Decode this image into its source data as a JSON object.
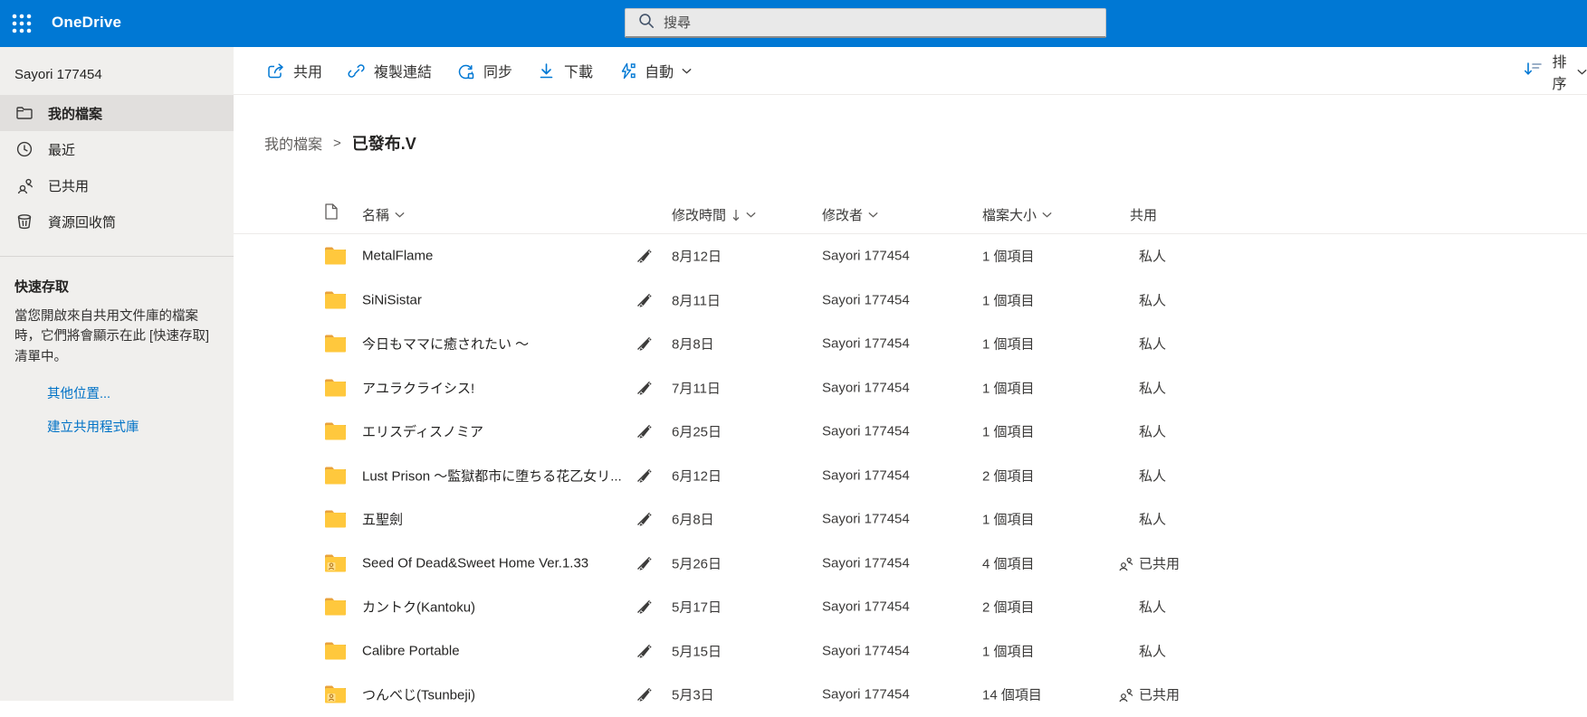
{
  "header": {
    "app_name": "OneDrive",
    "search_placeholder": "搜尋"
  },
  "sidebar": {
    "account_name": "Sayori 177454",
    "items": [
      {
        "label": "我的檔案",
        "icon": "folder-icon",
        "selected": true
      },
      {
        "label": "最近",
        "icon": "clock-icon",
        "selected": false
      },
      {
        "label": "已共用",
        "icon": "people-icon",
        "selected": false
      },
      {
        "label": "資源回收筒",
        "icon": "recycle-bin-icon",
        "selected": false
      }
    ],
    "quick_access": {
      "title": "快速存取",
      "description": "當您開啟來自共用文件庫的檔案時，它們將會顯示在此 [快速存取] 清單中。",
      "links": [
        {
          "label": "其他位置..."
        },
        {
          "label": "建立共用程式庫"
        }
      ]
    }
  },
  "toolbar": {
    "actions": [
      {
        "label": "共用",
        "icon": "share-icon"
      },
      {
        "label": "複製連結",
        "icon": "copy-link-icon"
      },
      {
        "label": "同步",
        "icon": "sync-icon"
      },
      {
        "label": "下載",
        "icon": "download-icon"
      },
      {
        "label": "自動",
        "icon": "automate-icon",
        "has_dropdown": true
      }
    ],
    "sort_label": "排序"
  },
  "breadcrumb": {
    "parent": "我的檔案",
    "separator": ">",
    "current": "已發布.V"
  },
  "table": {
    "columns": {
      "name": "名稱",
      "modified": "修改時間",
      "modified_by": "修改者",
      "file_size": "檔案大小",
      "sharing": "共用"
    },
    "sorted_by": "修改時間",
    "sort_direction": "descending",
    "rows": [
      {
        "name": "MetalFlame",
        "modified": "8月12日",
        "modified_by": "Sayori 177454",
        "file_size": "1 個項目",
        "sharing": "私人",
        "shared": false
      },
      {
        "name": "SiNiSistar",
        "modified": "8月11日",
        "modified_by": "Sayori 177454",
        "file_size": "1 個項目",
        "sharing": "私人",
        "shared": false
      },
      {
        "name": "今日もママに癒されたい ～",
        "modified": "8月8日",
        "modified_by": "Sayori 177454",
        "file_size": "1 個項目",
        "sharing": "私人",
        "shared": false
      },
      {
        "name": "アユラクライシス!",
        "modified": "7月11日",
        "modified_by": "Sayori 177454",
        "file_size": "1 個項目",
        "sharing": "私人",
        "shared": false
      },
      {
        "name": "エリスディスノミア",
        "modified": "6月25日",
        "modified_by": "Sayori 177454",
        "file_size": "1 個項目",
        "sharing": "私人",
        "shared": false
      },
      {
        "name": "Lust Prison ～監獄都市に堕ちる花乙女リ...",
        "modified": "6月12日",
        "modified_by": "Sayori 177454",
        "file_size": "2 個項目",
        "sharing": "私人",
        "shared": false
      },
      {
        "name": "五聖劍",
        "modified": "6月8日",
        "modified_by": "Sayori 177454",
        "file_size": "1 個項目",
        "sharing": "私人",
        "shared": false
      },
      {
        "name": "Seed Of Dead&Sweet Home Ver.1.33",
        "modified": "5月26日",
        "modified_by": "Sayori 177454",
        "file_size": "4 個項目",
        "sharing": "已共用",
        "shared": true
      },
      {
        "name": "カントク(Kantoku)",
        "modified": "5月17日",
        "modified_by": "Sayori 177454",
        "file_size": "2 個項目",
        "sharing": "私人",
        "shared": false
      },
      {
        "name": "Calibre Portable",
        "modified": "5月15日",
        "modified_by": "Sayori 177454",
        "file_size": "1 個項目",
        "sharing": "私人",
        "shared": false
      },
      {
        "name": "つんべじ(Tsunbeji)",
        "modified": "5月3日",
        "modified_by": "Sayori 177454",
        "file_size": "14 個項目",
        "sharing": "已共用",
        "shared": true
      }
    ]
  },
  "colors": {
    "brand_blue": "#0078d4",
    "sidebar_bg": "#f0efed",
    "selected_item_bg": "#e1dfdd",
    "folder_yellow": "#ffc83d",
    "folder_tab": "#e9a23b",
    "link_blue": "#0072c6",
    "text_primary": "#252423",
    "text_secondary": "#3b3a39"
  }
}
